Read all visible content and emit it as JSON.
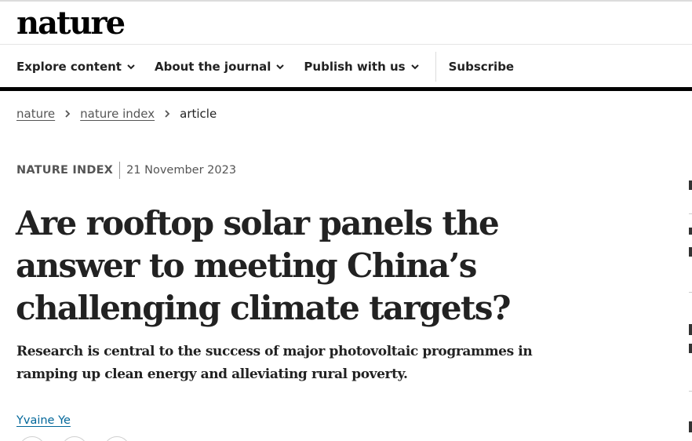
{
  "site": {
    "logo": "nature"
  },
  "nav": {
    "items": [
      {
        "label": "Explore content",
        "has_dropdown": true
      },
      {
        "label": "About the journal",
        "has_dropdown": true
      },
      {
        "label": "Publish with us",
        "has_dropdown": true
      }
    ],
    "subscribe": "Subscribe"
  },
  "breadcrumb": {
    "items": [
      "nature",
      "nature index"
    ],
    "current": "article"
  },
  "article": {
    "type": "NATURE INDEX",
    "date": "21 November 2023",
    "title": "Are rooftop solar panels the answer to meeting China’s challenging climate targets?",
    "standfirst": "Research is central to the success of major photovoltaic programmes in ramping up clean energy and alleviating rural poverty.",
    "author": "Yvaine Ye"
  },
  "colors": {
    "text": "#222222",
    "link": "#006699",
    "nav_bar": "#000000"
  },
  "icons": [
    "chevron-down-icon",
    "chevron-right-icon"
  ]
}
